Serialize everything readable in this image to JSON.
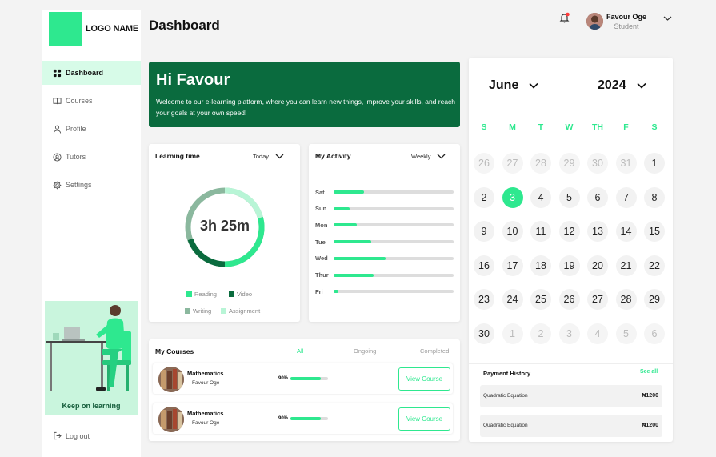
{
  "sidebar": {
    "logo_text": "LOGO NAME",
    "items": [
      {
        "label": "Dashboard",
        "icon": "grid-icon"
      },
      {
        "label": "Courses",
        "icon": "book-icon"
      },
      {
        "label": "Profile",
        "icon": "user-icon"
      },
      {
        "label": "Tutors",
        "icon": "user-circle-icon"
      },
      {
        "label": "Settings",
        "icon": "gear-icon"
      }
    ],
    "promo_text": "Keep on learning",
    "logout_label": "Log out"
  },
  "header": {
    "title": "Dashboard",
    "user_name": "Favour Oge",
    "user_role": "Student"
  },
  "welcome": {
    "heading": "Hi Favour",
    "text": "Welcome to our e-learning platform, where you can learn new things, improve your skills, and reach your goals at your own speed!"
  },
  "learning_time": {
    "title": "Learning time",
    "period": "Today",
    "total": "3h 25m",
    "legend": [
      {
        "label": "Reading",
        "color": "#2ee88f"
      },
      {
        "label": "Video",
        "color": "#0a6b3e"
      },
      {
        "label": "Writing",
        "color": "#8bb89e"
      },
      {
        "label": "Assignment",
        "color": "#b8f5d6"
      }
    ]
  },
  "activity": {
    "title": "My Activity",
    "period": "Weekly",
    "rows": [
      {
        "day": "Sat",
        "value": 0.25
      },
      {
        "day": "Sun",
        "value": 0.13
      },
      {
        "day": "Mon",
        "value": 0.19
      },
      {
        "day": "Tue",
        "value": 0.31
      },
      {
        "day": "Wed",
        "value": 0.43
      },
      {
        "day": "Thur",
        "value": 0.33
      },
      {
        "day": "Fri",
        "value": 0.04
      }
    ]
  },
  "courses": {
    "title": "My Courses",
    "tabs": [
      "All",
      "Ongoing",
      "Completed"
    ],
    "active_tab": "All",
    "items": [
      {
        "title": "Mathematics",
        "tutor": "Favour Oge",
        "progress_label": "90%",
        "progress": 0.8,
        "button": "View Course"
      },
      {
        "title": "Mathematics",
        "tutor": "Favour Oge",
        "progress_label": "90%",
        "progress": 0.8,
        "button": "View Course"
      }
    ]
  },
  "calendar": {
    "month": "June",
    "year": "2024",
    "weekdays": [
      "S",
      "M",
      "T",
      "W",
      "TH",
      "F",
      "S"
    ],
    "days": [
      {
        "d": "26",
        "muted": true
      },
      {
        "d": "27",
        "muted": true
      },
      {
        "d": "28",
        "muted": true
      },
      {
        "d": "29",
        "muted": true
      },
      {
        "d": "30",
        "muted": true
      },
      {
        "d": "31",
        "muted": true
      },
      {
        "d": "1"
      },
      {
        "d": "2"
      },
      {
        "d": "3",
        "selected": true
      },
      {
        "d": "4"
      },
      {
        "d": "5"
      },
      {
        "d": "6"
      },
      {
        "d": "7"
      },
      {
        "d": "8"
      },
      {
        "d": "9"
      },
      {
        "d": "10"
      },
      {
        "d": "11"
      },
      {
        "d": "12"
      },
      {
        "d": "13"
      },
      {
        "d": "14"
      },
      {
        "d": "15"
      },
      {
        "d": "16"
      },
      {
        "d": "17"
      },
      {
        "d": "18"
      },
      {
        "d": "19"
      },
      {
        "d": "20"
      },
      {
        "d": "21"
      },
      {
        "d": "22"
      },
      {
        "d": "23"
      },
      {
        "d": "24"
      },
      {
        "d": "25"
      },
      {
        "d": "26"
      },
      {
        "d": "27"
      },
      {
        "d": "28"
      },
      {
        "d": "29"
      },
      {
        "d": "30"
      },
      {
        "d": "1",
        "muted": true
      },
      {
        "d": "2",
        "muted": true
      },
      {
        "d": "3",
        "muted": true
      },
      {
        "d": "4",
        "muted": true
      },
      {
        "d": "5",
        "muted": true
      },
      {
        "d": "6",
        "muted": true
      }
    ]
  },
  "payments": {
    "title": "Payment History",
    "see_all": "See all",
    "items": [
      {
        "name": "Quadratic Equation",
        "amount": "₦1200"
      },
      {
        "name": "Quadratic Equation",
        "amount": "₦1200"
      }
    ]
  },
  "colors": {
    "accent": "#2ee88f",
    "brand_dark": "#0a6b3e"
  }
}
